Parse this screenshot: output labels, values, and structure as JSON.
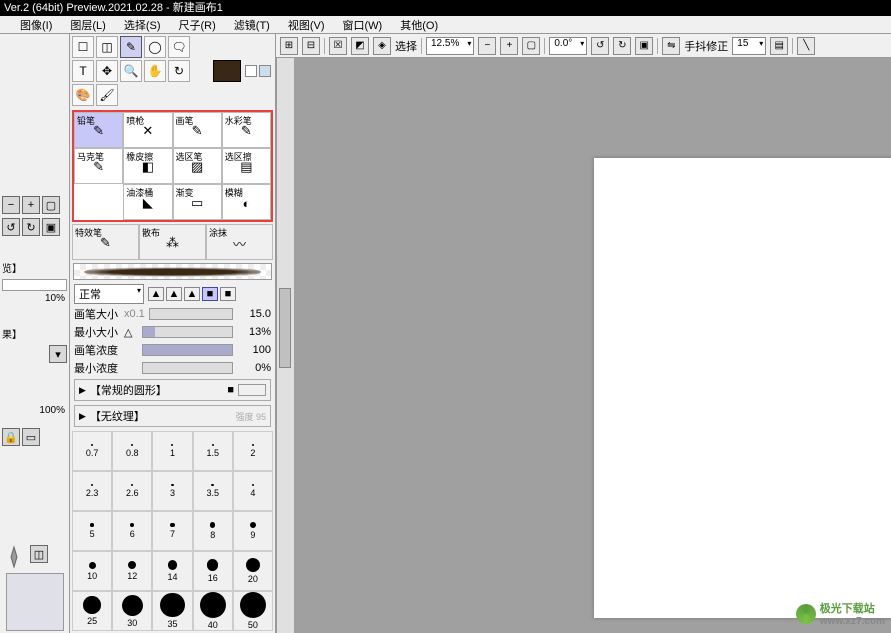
{
  "title": "Ver.2 (64bit) Preview.2021.02.28 - 新建画布1",
  "menu": [
    "图像(I)",
    "图层(L)",
    "选择(S)",
    "尺子(R)",
    "滤镜(T)",
    "视图(V)",
    "窗口(W)",
    "其他(O)"
  ],
  "options": {
    "select_label": "选择",
    "zoom": "12.5%",
    "angle": "0.0°",
    "stabilizer_label": "手抖修正",
    "stabilizer_val": "15"
  },
  "tools": {
    "row1": [
      "☐",
      "◫",
      "✎",
      "◯",
      "🗨",
      "T"
    ],
    "row2": [
      "✥",
      "🔍",
      "✋",
      "↻",
      "🎨",
      "🖌"
    ]
  },
  "brushes": [
    {
      "name": "铅笔",
      "icon": "✎",
      "sel": true
    },
    {
      "name": "喷枪",
      "icon": "✕"
    },
    {
      "name": "画笔",
      "icon": "✎"
    },
    {
      "name": "水彩笔",
      "icon": "✎"
    },
    {
      "name": "马克笔",
      "icon": "✎"
    },
    {
      "name": "橡皮擦",
      "icon": "◧"
    },
    {
      "name": "选区笔",
      "icon": "▨"
    },
    {
      "name": "选区擦",
      "icon": "▤"
    }
  ],
  "brushes2": [
    {
      "name": "油漆桶",
      "icon": "◣"
    },
    {
      "name": "渐变",
      "icon": "▭"
    },
    {
      "name": "模糊",
      "icon": "◐"
    }
  ],
  "brushes3": [
    {
      "name": "特效笔",
      "icon": "✎"
    },
    {
      "name": "散布",
      "icon": "⁂"
    },
    {
      "name": "涂抹",
      "icon": "〰"
    }
  ],
  "blend_mode": "正常",
  "props": {
    "size_label": "画笔大小",
    "size_mult": "x0.1",
    "size_val": "15.0",
    "min_size_label": "最小大小",
    "min_size_val": "13%",
    "density_label": "画笔浓度",
    "density_val": "100",
    "min_density_label": "最小浓度",
    "min_density_val": "0%"
  },
  "shape_section": "【常规的圆形】",
  "texture_section": "【无纹理】",
  "texture_val": "强度  95",
  "sizes": [
    0.7,
    0.8,
    1,
    1.5,
    2,
    2.3,
    2.6,
    3,
    3.5,
    4,
    5,
    6,
    7,
    8,
    9,
    10,
    12,
    14,
    16,
    20,
    25,
    30,
    35,
    40,
    50
  ],
  "left": {
    "label1": "览】",
    "pct1": "10%",
    "label2": "果】",
    "pct2": "100%"
  },
  "watermark": {
    "text": "极光下载站",
    "url": "www.xz7.com"
  }
}
